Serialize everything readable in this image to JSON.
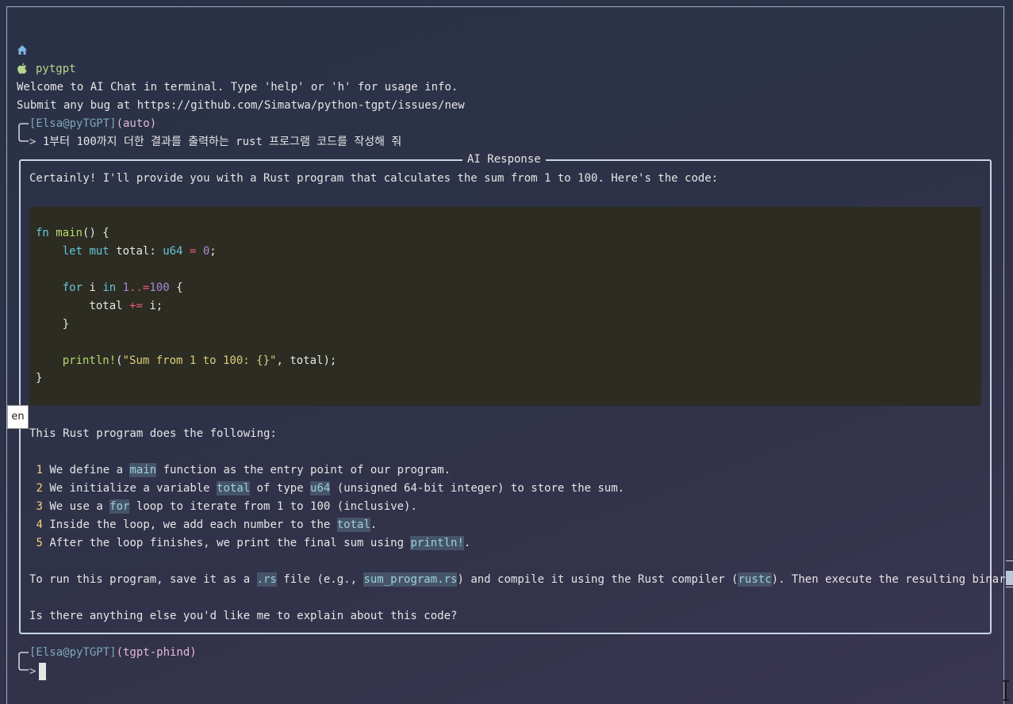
{
  "app": {
    "name": "pytgpt",
    "welcome": "Welcome to AI Chat in terminal. Type 'help' or 'h' for usage info.",
    "bug_report": "Submit any bug at https://github.com/Simatwa/python-tgpt/issues/new"
  },
  "prompt1": {
    "user": "[Elsa@pyTGPT]",
    "mode": "(auto)",
    "input": "1부터 100까지 더한 결과를 출력하는 rust 프로그램 코드를 작성해 줘"
  },
  "response": {
    "title": "AI Response",
    "intro": "Certainly! I'll provide you with a Rust program that calculates the sum from 1 to 100. Here's the code:",
    "code": {
      "l1_fn": "fn",
      "l1_name": "main",
      "l1_rest": "() {",
      "l2_let": "let",
      "l2_mut": "mut",
      "l2_var": "total:",
      "l2_type": "u64",
      "l2_eq": "=",
      "l2_zero": "0",
      "l2_end": ";",
      "l3_for": "for",
      "l3_i": "i",
      "l3_in": "in",
      "l3_start": "1",
      "l3_range": "..=",
      "l3_end_num": "100",
      "l3_brace": "{",
      "l4_total": "total",
      "l4_op": "+=",
      "l4_rest": "i;",
      "l5": "}",
      "l6_macro": "println!",
      "l6_open": "(",
      "l6_str1": "\"Sum from 1 to 100: ",
      "l6_fmt": "{}",
      "l6_str2": "\"",
      "l6_rest": ", total);",
      "l7": "}"
    },
    "desc_intro": "This Rust program does the following:",
    "items": [
      {
        "n": "1",
        "a": "We define a ",
        "code": "main",
        "b": " function as the entry point of our program."
      },
      {
        "n": "2",
        "a": "We initialize a variable ",
        "code": "total",
        "b": " of type ",
        "code2": "u64",
        "c": " (unsigned 64-bit integer) to store the sum."
      },
      {
        "n": "3",
        "a": "We use a ",
        "code": "for",
        "b": " loop to iterate from 1 to 100 (inclusive)."
      },
      {
        "n": "4",
        "a": "Inside the loop, we add each number to the ",
        "code": "total",
        "b": "."
      },
      {
        "n": "5",
        "a": "After the loop finishes, we print the final sum using ",
        "code": "println!",
        "b": "."
      }
    ],
    "run": {
      "a": "To run this program, save it as a ",
      "code1": ".rs",
      "b": " file (e.g., ",
      "code2": "sum_program.rs",
      "c": ") and compile it using the Rust compiler (",
      "code3": "rustc",
      "d": "). Then execute the resulting binary."
    },
    "closing": "Is there anything else you'd like me to explain about this code?"
  },
  "prompt2": {
    "user": "[Elsa@pyTGPT]",
    "mode": "(tgpt-phind)",
    "arrow": ">"
  },
  "lang_badge": "en",
  "colors": {
    "background": "#2d3248",
    "code_bg": "#2c2c23",
    "inline_code_bg": "#46546a",
    "app_name": "#b5d68b",
    "user": "#7fa7b8",
    "mode": "#e3b9d6"
  }
}
